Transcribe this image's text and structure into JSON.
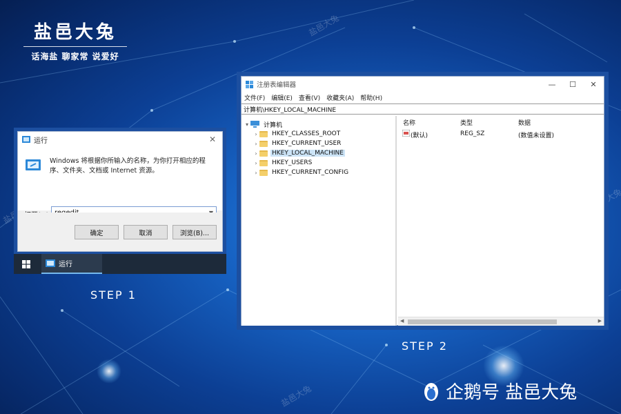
{
  "brand": {
    "name": "盐邑大兔",
    "slogan": "话海盐 聊家常 说爱好"
  },
  "watermarks": {
    "text": "盐邑大兔",
    "bottom_right": "企鹅号 盐邑大兔"
  },
  "run_dialog": {
    "title": "运行",
    "description": "Windows 将根据你所输入的名称，为你打开相应的程序、文件夹、文档或 Internet 资源。",
    "open_label": "打开(O):",
    "input_value": "regedit",
    "buttons": {
      "ok": "确定",
      "cancel": "取消",
      "browse": "浏览(B)..."
    }
  },
  "taskbar": {
    "item_label": "运行"
  },
  "steps": {
    "step1": "STEP 1",
    "step2": "STEP 2"
  },
  "regedit": {
    "title": "注册表编辑器",
    "menu": [
      "文件(F)",
      "编辑(E)",
      "查看(V)",
      "收藏夹(A)",
      "帮助(H)"
    ],
    "address": "计算机\\HKEY_LOCAL_MACHINE",
    "tree": {
      "root": "计算机",
      "children": [
        {
          "label": "HKEY_CLASSES_ROOT",
          "selected": false
        },
        {
          "label": "HKEY_CURRENT_USER",
          "selected": false
        },
        {
          "label": "HKEY_LOCAL_MACHINE",
          "selected": true
        },
        {
          "label": "HKEY_USERS",
          "selected": false
        },
        {
          "label": "HKEY_CURRENT_CONFIG",
          "selected": false
        }
      ]
    },
    "columns": [
      "名称",
      "类型",
      "数据"
    ],
    "rows": [
      {
        "name": "(默认)",
        "type": "REG_SZ",
        "data": "(数值未设置)"
      }
    ]
  }
}
